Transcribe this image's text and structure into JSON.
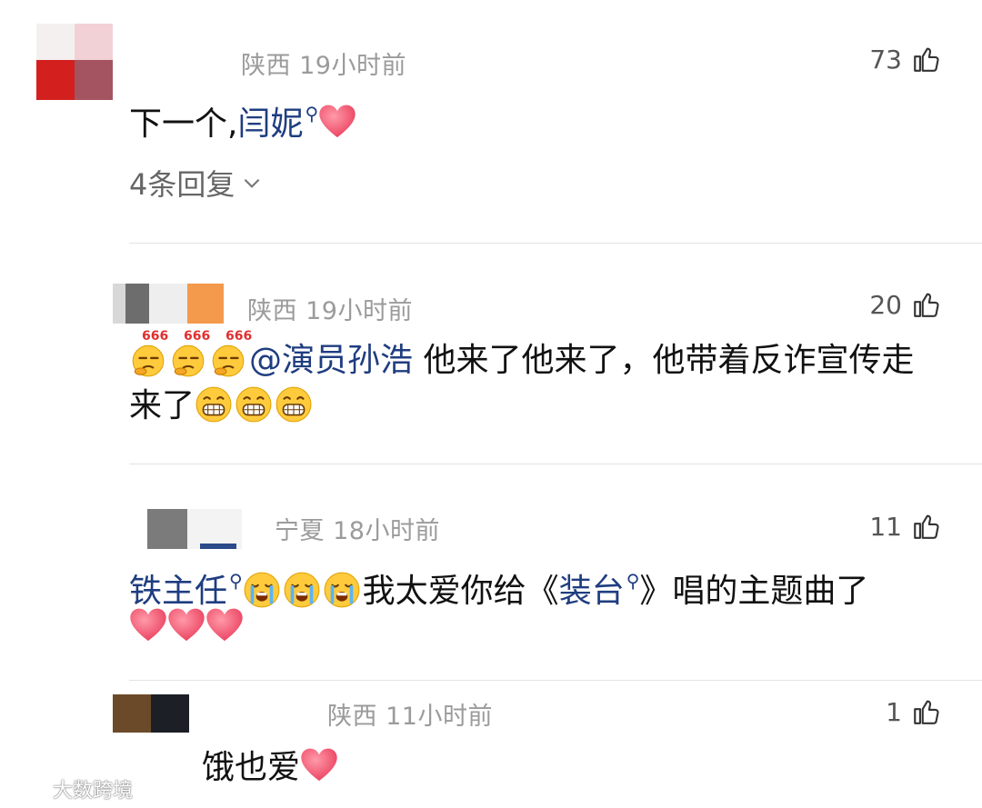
{
  "comments": [
    {
      "location": "陕西",
      "time": "19小时前",
      "likes": "73",
      "text_parts": [
        "下一个,",
        "闫妮"
      ],
      "reply_count": "4条回复"
    },
    {
      "location": "陕西",
      "time": "19小时前",
      "likes": "20",
      "mention": "@演员孙浩",
      "line1_rest": " 他来了他来了，他带着反诈宣传走",
      "line2": "来了",
      "emoji_caption": "666"
    },
    {
      "location": "宁夏",
      "time": "18小时前",
      "likes": "11",
      "topic": "铁主任",
      "mid": "我太爱你给《",
      "topic2": "装台",
      "end": "》唱的主题曲了"
    },
    {
      "location": "陕西",
      "time": "11小时前",
      "likes": "1",
      "text": "饿也爱"
    }
  ],
  "icons": {
    "like": "thumbs-up-icon",
    "search": "search-icon",
    "heart": "heart-emoji",
    "chevron": "chevron-down-icon"
  },
  "watermark": {
    "text": "大数跨境"
  },
  "colors": {
    "link": "#1f3d80",
    "heart": "#f0556e",
    "meta": "#9b9b9b"
  }
}
